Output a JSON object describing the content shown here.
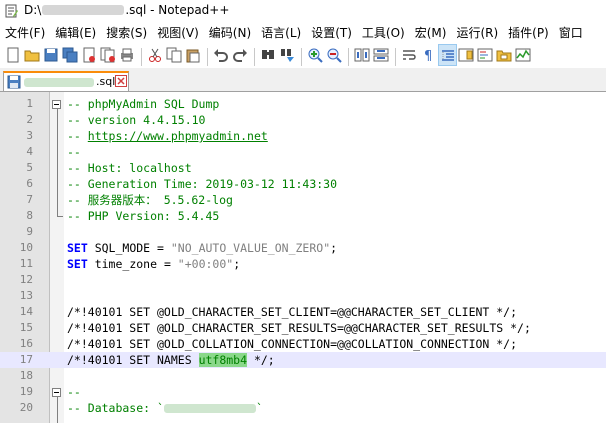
{
  "window": {
    "title_prefix": "D:\\",
    "title_suffix": ".sql - Notepad++"
  },
  "menu": [
    "文件(F)",
    "编辑(E)",
    "搜索(S)",
    "视图(V)",
    "编码(N)",
    "语言(L)",
    "设置(T)",
    "工具(O)",
    "宏(M)",
    "运行(R)",
    "插件(P)",
    "窗口"
  ],
  "toolbar_icons": [
    "new-file-icon",
    "open-file-icon",
    "save-icon",
    "save-all-icon",
    "close-icon",
    "close-all-icon",
    "print-icon",
    "cut-icon",
    "copy-icon",
    "paste-icon",
    "undo-icon",
    "redo-icon",
    "find-icon",
    "replace-icon",
    "zoom-in-icon",
    "zoom-out-icon",
    "sync-vertical-icon",
    "sync-horizontal-icon",
    "word-wrap-icon",
    "show-all-chars-icon",
    "indent-guide-icon",
    "doc-map-icon",
    "function-list-icon",
    "folder-workspace-icon",
    "monitoring-icon"
  ],
  "tab": {
    "label": ".sql"
  },
  "editor": {
    "colors": {
      "comment": "#008000",
      "keyword": "#0000ff",
      "string": "#808080",
      "current_line": "#e8e8ff",
      "highlight": "#8ad88a"
    },
    "lines": [
      {
        "n": "1",
        "text": "-- phpMyAdmin SQL Dump"
      },
      {
        "n": "2",
        "text": "-- version 4.4.15.10"
      },
      {
        "n": "3",
        "text": "-- ",
        "link": "https://www.phpmyadmin.net"
      },
      {
        "n": "4",
        "text": "--"
      },
      {
        "n": "5",
        "text": "-- Host: localhost"
      },
      {
        "n": "6",
        "text": "-- Generation Time: 2019-03-12 11:43:30"
      },
      {
        "n": "7",
        "text": "-- 服务器版本： 5.5.62-log"
      },
      {
        "n": "8",
        "text": "-- PHP Version: 5.4.45"
      },
      {
        "n": "9",
        "text": ""
      },
      {
        "n": "10",
        "kw": "SET",
        "rest": " SQL_MODE = ",
        "str": "\"NO_AUTO_VALUE_ON_ZERO\"",
        "end": ";"
      },
      {
        "n": "11",
        "kw": "SET",
        "rest": " time_zone = ",
        "str": "\"+00:00\"",
        "end": ";"
      },
      {
        "n": "12",
        "text": ""
      },
      {
        "n": "13",
        "text": ""
      },
      {
        "n": "14",
        "text": "/*!40101 SET @OLD_CHARACTER_SET_CLIENT=@@CHARACTER_SET_CLIENT */;"
      },
      {
        "n": "15",
        "text": "/*!40101 SET @OLD_CHARACTER_SET_RESULTS=@@CHARACTER_SET_RESULTS */;"
      },
      {
        "n": "16",
        "text": "/*!40101 SET @OLD_COLLATION_CONNECTION=@@COLLATION_CONNECTION */;"
      },
      {
        "n": "17",
        "pre": "/*!40101 SET NAMES ",
        "hl": "utf8mb4",
        "post": " */;"
      },
      {
        "n": "18",
        "text": ""
      },
      {
        "n": "19",
        "text": "--"
      },
      {
        "n": "20",
        "text": "-- Database: `",
        "end": "`"
      }
    ]
  }
}
